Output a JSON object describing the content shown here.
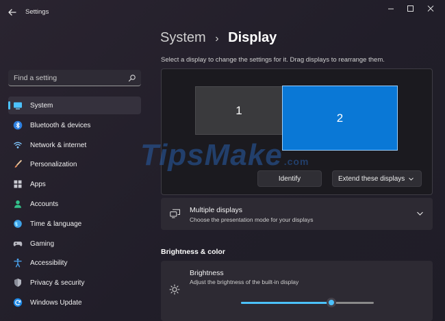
{
  "window": {
    "title": "Settings",
    "controls": [
      "minimize-icon",
      "maximize-icon",
      "close-icon"
    ]
  },
  "search": {
    "placeholder": "Find a setting",
    "icon": "search-icon"
  },
  "sidebar": {
    "items": [
      {
        "label": "System",
        "icon": "system-icon",
        "active": true
      },
      {
        "label": "Bluetooth & devices",
        "icon": "bluetooth-icon"
      },
      {
        "label": "Network & internet",
        "icon": "wifi-icon"
      },
      {
        "label": "Personalization",
        "icon": "brush-icon"
      },
      {
        "label": "Apps",
        "icon": "apps-icon"
      },
      {
        "label": "Accounts",
        "icon": "accounts-icon"
      },
      {
        "label": "Time & language",
        "icon": "globe-icon"
      },
      {
        "label": "Gaming",
        "icon": "gamepad-icon"
      },
      {
        "label": "Accessibility",
        "icon": "accessibility-icon"
      },
      {
        "label": "Privacy & security",
        "icon": "shield-icon"
      },
      {
        "label": "Windows Update",
        "icon": "update-icon"
      }
    ]
  },
  "breadcrumb": {
    "parent": "System",
    "separator": "›",
    "current": "Display"
  },
  "display_arrangement": {
    "hint": "Select a display to change the settings for it. Drag displays to rearrange them.",
    "monitors": [
      {
        "label": "1",
        "selected": false
      },
      {
        "label": "2",
        "selected": true
      }
    ],
    "identify_label": "Identify",
    "mode_select": "Extend these displays"
  },
  "multiple_displays": {
    "title": "Multiple displays",
    "subtitle": "Choose the presentation mode for your displays"
  },
  "brightness_section": {
    "heading": "Brightness & color",
    "brightness": {
      "title": "Brightness",
      "subtitle": "Adjust the brightness of the built-in display",
      "value_fraction": 0.68
    }
  },
  "watermark": {
    "text": "TipsMake",
    "suffix": ".com"
  },
  "colors": {
    "accent": "#4cc2ff",
    "selected_monitor": "#0a78d6",
    "background": "#221f2a",
    "card": "#2d2a33"
  }
}
